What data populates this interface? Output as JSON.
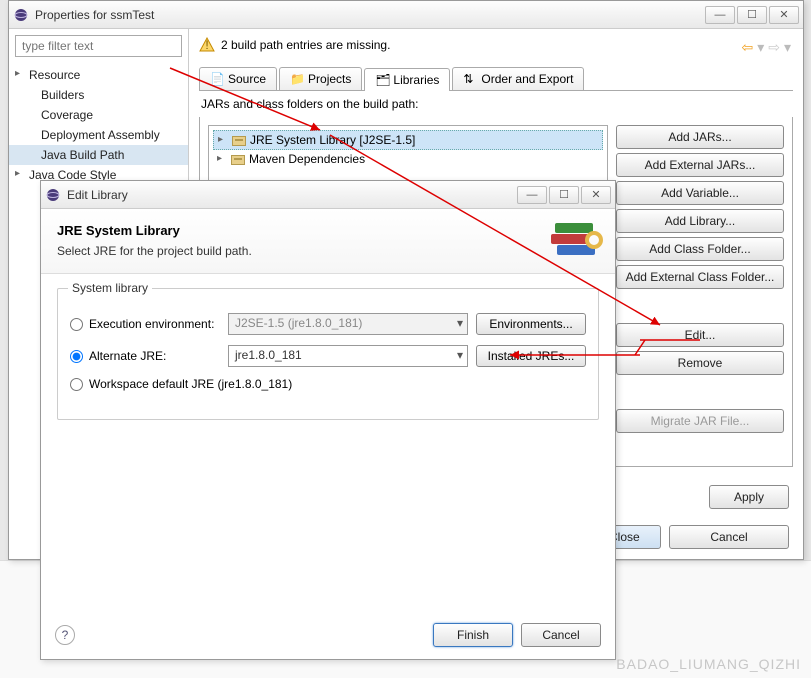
{
  "props": {
    "title": "Properties for ssmTest",
    "filter_placeholder": "type filter text",
    "tree": {
      "resource": "Resource",
      "builders": "Builders",
      "coverage": "Coverage",
      "deployment": "Deployment Assembly",
      "javabuildpath": "Java Build Path",
      "javacodestyle": "Java Code Style"
    },
    "warning": "2 build path entries are missing.",
    "tabs": {
      "source": "Source",
      "projects": "Projects",
      "libraries": "Libraries",
      "order": "Order and Export"
    },
    "jar_label": "JARs and class folders on the build path:",
    "jars": {
      "jre": "JRE System Library [J2SE-1.5]",
      "maven": "Maven Dependencies"
    },
    "buttons": {
      "addjars": "Add JARs...",
      "addextjars": "Add External JARs...",
      "addvar": "Add Variable...",
      "addlib": "Add Library...",
      "addclassfolder": "Add Class Folder...",
      "addextclassfolder": "Add External Class Folder...",
      "edit": "Edit...",
      "remove": "Remove",
      "migrate": "Migrate JAR File...",
      "apply": "Apply",
      "applyclose": "Apply and Close",
      "cancel": "Cancel"
    }
  },
  "editlib": {
    "title": "Edit Library",
    "heading": "JRE System Library",
    "subheading": "Select JRE for the project build path.",
    "group_label": "System library",
    "radios": {
      "execenv": "Execution environment:",
      "altjre": "Alternate JRE:",
      "wsdefault": "Workspace default JRE (jre1.8.0_181)"
    },
    "combos": {
      "execenv_value": "J2SE-1.5 (jre1.8.0_181)",
      "altjre_value": "jre1.8.0_181"
    },
    "side_buttons": {
      "environments": "Environments...",
      "installed": "Installed JREs..."
    },
    "buttons": {
      "finish": "Finish",
      "cancel": "Cancel"
    },
    "help": "?"
  },
  "watermark": "BADAO_LIUMANG_QIZHI"
}
